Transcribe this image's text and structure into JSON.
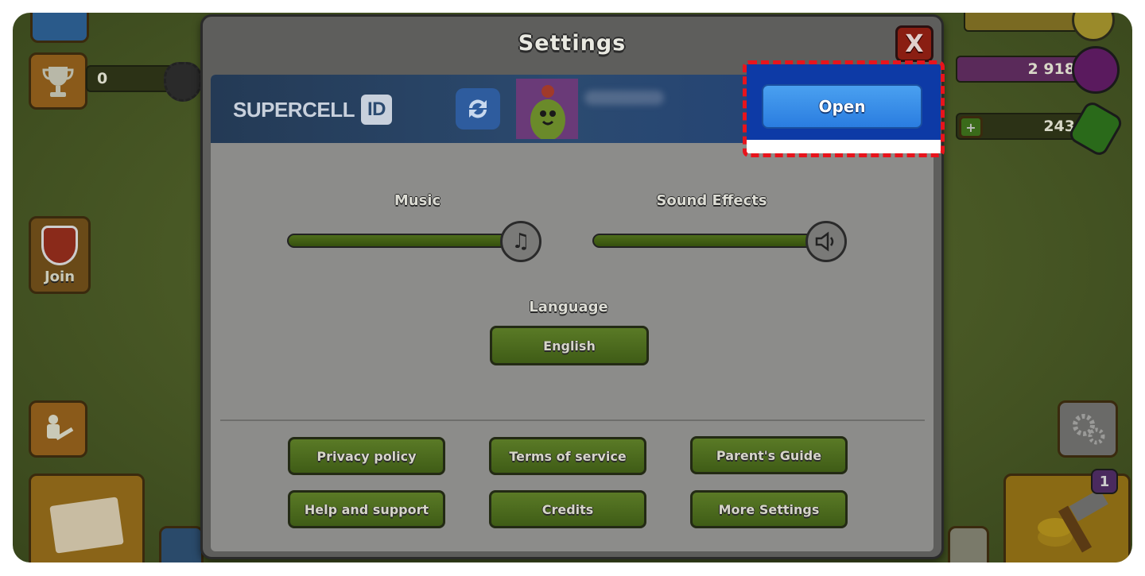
{
  "hud": {
    "trophy_count": "0",
    "elixir_value": "2 918",
    "gems_value": "243",
    "clan_button_label": "Join",
    "builder_badge_count": "1"
  },
  "settings": {
    "title": "Settings",
    "close_label": "X",
    "supercell_id": {
      "brand_text": "SUPERCELL",
      "id_badge": "ID",
      "open_button": "Open"
    },
    "music_label": "Music",
    "sound_effects_label": "Sound Effects",
    "language_label": "Language",
    "language_value": "English",
    "buttons": {
      "privacy_policy": "Privacy policy",
      "terms_of_service": "Terms of service",
      "parents_guide": "Parent's Guide",
      "help_and_support": "Help and support",
      "credits": "Credits",
      "more_settings": "More Settings"
    }
  },
  "colors": {
    "highlight": "#e8141c",
    "open_button": "#2a7de0",
    "green_button": "#4f6e20"
  },
  "icons": {
    "switch_account": "sync-icon",
    "music": "music-note-icon",
    "sound": "speaker-icon",
    "close": "close-icon"
  }
}
